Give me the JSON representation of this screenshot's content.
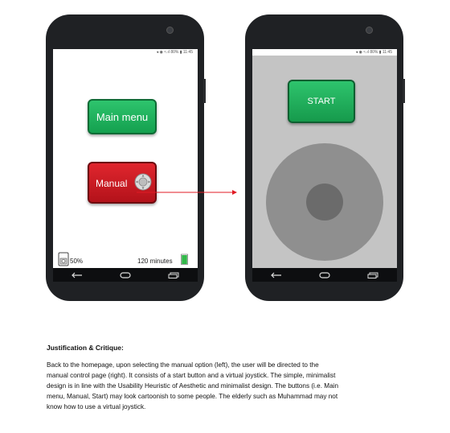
{
  "left_phone": {
    "status_text": "◂ ◉ ≈.ıl 80% ▮ 11:45",
    "main_menu_label": "Main menu",
    "manual_label": "Manual",
    "battery_label": "50%",
    "time_remaining_label": "120 minutes"
  },
  "right_phone": {
    "status_text": "◂ ◉ ≈.ıl 80% ▮ 11:45",
    "start_label": "START"
  },
  "critique": {
    "heading": "Justification & Critique:",
    "lines": [
      "Back to the homepage, upon selecting the manual option (left), the user will be directed to the",
      "manual control page (right). It consists of a start button and a virtual joystick. The simple, minimalist",
      "design is in line with the Usability Heuristic of Aesthetic and minimalist design. The buttons (i.e. Main",
      "menu, Manual, Start) may look cartoonish to some people. The elderly such as Muhammad may not",
      "know how to use a virtual joystick."
    ]
  },
  "colors": {
    "green_button": "#1fae5b",
    "red_button": "#cc1b23",
    "arrow": "#e01b24",
    "joystick_outer": "#8f8f8f",
    "joystick_inner": "#6b6b6b",
    "manual_screen_bg": "#c4c4c4"
  }
}
